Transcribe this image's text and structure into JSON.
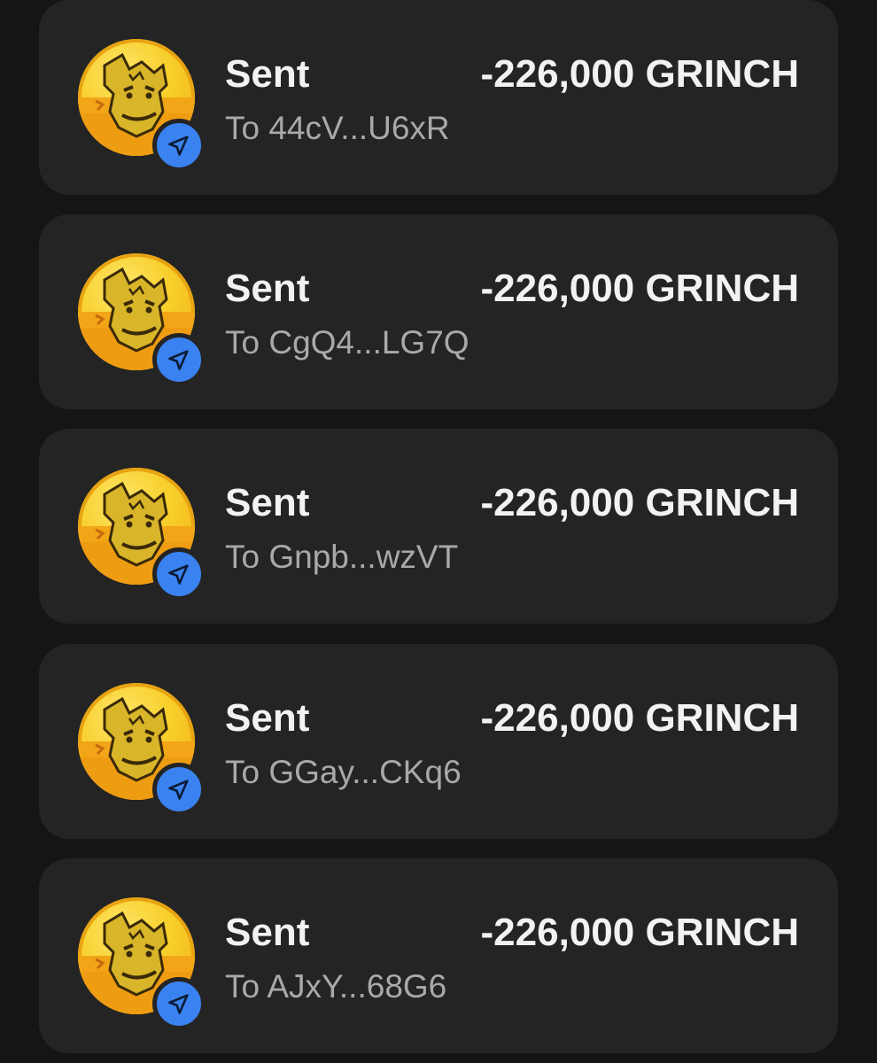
{
  "transactions": [
    {
      "type": "Sent",
      "amount": "-226,000 GRINCH",
      "recipient": "To 44cV...U6xR",
      "token_icon": "grinch-token-icon",
      "status_icon": "send-arrow-icon"
    },
    {
      "type": "Sent",
      "amount": "-226,000 GRINCH",
      "recipient": "To CgQ4...LG7Q",
      "token_icon": "grinch-token-icon",
      "status_icon": "send-arrow-icon"
    },
    {
      "type": "Sent",
      "amount": "-226,000 GRINCH",
      "recipient": "To Gnpb...wzVT",
      "token_icon": "grinch-token-icon",
      "status_icon": "send-arrow-icon"
    },
    {
      "type": "Sent",
      "amount": "-226,000 GRINCH",
      "recipient": "To GGay...CKq6",
      "token_icon": "grinch-token-icon",
      "status_icon": "send-arrow-icon"
    },
    {
      "type": "Sent",
      "amount": "-226,000 GRINCH",
      "recipient": "To AJxY...68G6",
      "token_icon": "grinch-token-icon",
      "status_icon": "send-arrow-icon"
    }
  ],
  "colors": {
    "background": "#151515",
    "card": "#242424",
    "primary_text": "#f2f2f2",
    "secondary_text": "#a9a9a9",
    "badge_blue": "#3a82f0",
    "coin_yellow": "#f7cf2a"
  }
}
